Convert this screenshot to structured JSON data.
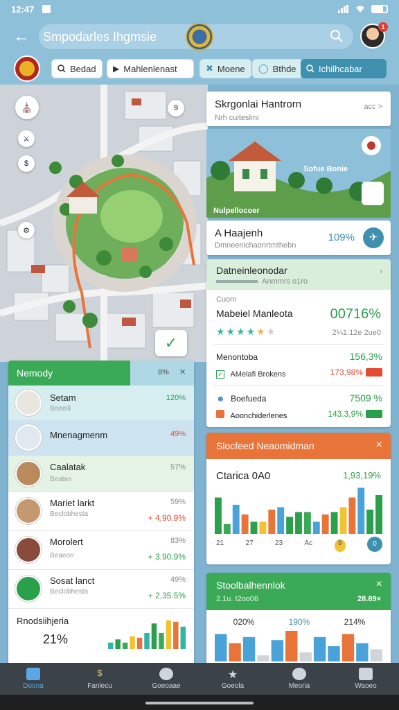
{
  "status": {
    "time": "12:47"
  },
  "header": {
    "title": "Smpodarles Ihgmsie"
  },
  "filters": {
    "chips": [
      "Bedad",
      "Mahlenlenast",
      "Moene",
      "Bthde",
      "Ichilhcabar"
    ]
  },
  "map": {
    "pin_label_a": "9",
    "check_symbol": "✓"
  },
  "right_top": {
    "title": "Skrgonlai Hantrorn",
    "subtitle": "Nrh cuiteslmi",
    "meta": "acc >",
    "image_label": "Sofue Bonie",
    "image_caption": "Nulpellocoer"
  },
  "info": {
    "title": "A Haajenh",
    "subtitle": "Dmneenichaonrtmthebn",
    "value": "109%"
  },
  "rating": {
    "header": "Datneinleonodar",
    "header_sub": "Anmmrs o1ro",
    "tag": "Cuom",
    "name": "Mabeiel Manleota",
    "value": "00716%",
    "score": "2¼1.12e 2ue0",
    "stars": 4.5,
    "rows": [
      {
        "label": "Menontoba",
        "value": "156,3%",
        "color": "green"
      },
      {
        "label": "AMelafi Brokens",
        "value": "173,98%",
        "color": "red"
      },
      {
        "label": "Boefueda",
        "value": "7509 %",
        "color": "green"
      },
      {
        "label": "Aoonchiderlenes",
        "value": "143.3,9%",
        "color": "green"
      }
    ]
  },
  "chart_card": {
    "header": "Slocfeed Neaomidman",
    "title": "Ctarica 0A0",
    "value": "1,93,19%",
    "x_labels": [
      "21",
      "27",
      "23",
      "Ac",
      "9",
      "0"
    ]
  },
  "stats_card": {
    "header": "Stoolbalhennlok",
    "sub": "2.1u. I2oo06",
    "value": "28.89×",
    "cols": [
      "020%",
      "190%",
      "214%"
    ]
  },
  "list": {
    "header": "Nemody",
    "header_pct": "8%",
    "rows": [
      {
        "name": "Setam",
        "sub": "Boeeili",
        "pct": "120%",
        "pct_color": "green",
        "delta": ""
      },
      {
        "name": "Mnenagmenm",
        "sub": "",
        "pct": "49%",
        "pct_color": "red",
        "delta": ""
      },
      {
        "name": "Caalatak",
        "sub": "Beabin",
        "pct": "57%",
        "pct_color": "muted",
        "delta": ""
      },
      {
        "name": "Mariet larkt",
        "sub": "Beclobhesta",
        "pct": "59%",
        "pct_color": "muted",
        "delta": "+ 4,90.9%",
        "delta_color": "red"
      },
      {
        "name": "Morolert",
        "sub": "Beaeon",
        "pct": "83%",
        "pct_color": "muted",
        "delta": "+ 3.90.9%",
        "delta_color": "green"
      },
      {
        "name": "Sosat lanct",
        "sub": "Beclobhesta",
        "pct": "49%",
        "pct_color": "muted",
        "delta": "+ 2,35.5%",
        "delta_color": "green"
      }
    ],
    "footer_title": "Rnodsiihjeria",
    "footer_value": "21%"
  },
  "nav": {
    "items": [
      "Doona",
      "Fanlecu",
      "Goeoaae",
      "Goeola",
      "Meoria",
      "Waoeo"
    ]
  },
  "colors": {
    "green": "#2aa04a",
    "red": "#e24a33",
    "orange": "#e8743a",
    "blue": "#3f8fae"
  }
}
